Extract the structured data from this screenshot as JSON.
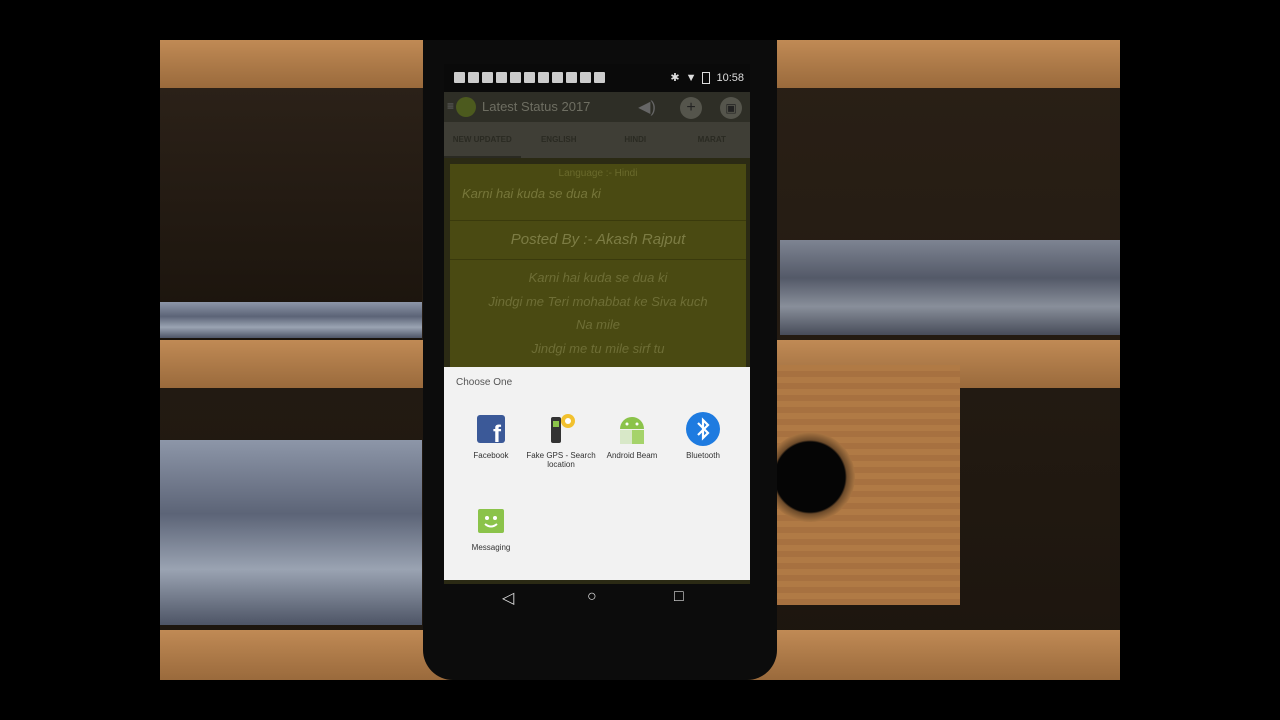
{
  "status_bar": {
    "time": "10:58",
    "notification_icons": [
      "back-icon",
      "facebook-icon",
      "facebook-icon",
      "facebook-icon",
      "facebook-icon",
      "facebook-icon",
      "facebook-icon",
      "facebook-icon",
      "facebook-icon",
      "facebook-icon",
      "facebook-icon"
    ]
  },
  "app_bar": {
    "title": "Latest Status 2017",
    "menu_icon": "menu-icon",
    "volume_icon": "volume-icon",
    "add_icon": "add-icon",
    "gift_icon": "gift-icon"
  },
  "tabs": [
    {
      "label": "NEW UPDATED",
      "active": true
    },
    {
      "label": "ENGLISH",
      "active": false
    },
    {
      "label": "HINDI",
      "active": false
    },
    {
      "label": "MARAT",
      "active": false
    }
  ],
  "status_card": {
    "language_line": "Language :- Hindi",
    "preview_line": "Karni hai kuda se dua ki",
    "posted_by": "Posted By :- Akash Rajput",
    "poem_lines": [
      "Karni hai kuda se dua ki",
      "Jindgi me Teri mohabbat ke Siva kuch",
      "Na mile",
      "Jindgi me tu mile sirf tu"
    ]
  },
  "share_sheet": {
    "title": "Choose One",
    "apps": [
      {
        "label": "Facebook",
        "icon": "facebook-icon"
      },
      {
        "label": "Fake GPS - Search location",
        "icon": "fake-gps-icon"
      },
      {
        "label": "Android Beam",
        "icon": "android-beam-icon"
      },
      {
        "label": "Bluetooth",
        "icon": "bluetooth-icon"
      },
      {
        "label": "Messaging",
        "icon": "messaging-icon"
      }
    ]
  },
  "nav_bar": {
    "back": "back-icon",
    "home": "home-icon",
    "recents": "recents-icon"
  },
  "colors": {
    "facebook": "#3b5998",
    "bluetooth": "#1e7be0",
    "android_green": "#8bc34a",
    "sheet_bg": "#f2f2f2"
  }
}
